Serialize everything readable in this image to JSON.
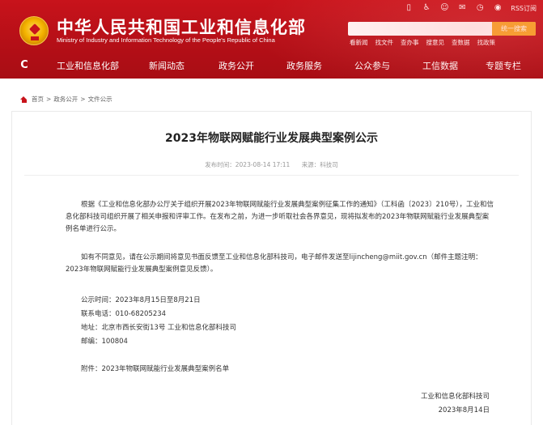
{
  "header": {
    "title": "中华人民共和国工业和信息化部",
    "subtitle": "Ministry of Industry and Information Technology of the People's Republic of China",
    "top_icons": [
      "mobile-icon",
      "accessibility-icon",
      "elder-icon",
      "mail-icon",
      "clock-icon",
      "weibo-icon"
    ],
    "rss_label": "RSS订阅",
    "search_placeholder": "",
    "search_button": "统一搜索",
    "hot_links": [
      "看新闻",
      "找文件",
      "查办事",
      "搜意见",
      "查数据",
      "找政策"
    ]
  },
  "nav": {
    "items": [
      "工业和信息化部",
      "新闻动态",
      "政务公开",
      "政务服务",
      "公众参与",
      "工信数据",
      "专题专栏"
    ]
  },
  "breadcrumb": [
    "首页",
    "政务公开",
    "文件公示"
  ],
  "article": {
    "title": "2023年物联网赋能行业发展典型案例公示",
    "publish_label": "发布时间：2023-08-14 17:11",
    "source_label": "来源：科技司",
    "p1": "根据《工业和信息化部办公厅关于组织开展2023年物联网赋能行业发展典型案例征集工作的通知》（工科函〔2023〕210号），工业和信息化部科技司组织开展了相关申报和评审工作。在发布之前，为进一步听取社会各界意见，现将拟发布的2023年物联网赋能行业发展典型案例名单进行公示。",
    "p2": "如有不同意见，请在公示期间将意见书面反馈至工业和信息化部科技司，电子邮件发送至lijincheng@miit.gov.cn（邮件主题注明：2023年物联网赋能行业发展典型案例意见反馈）。",
    "period": "公示时间：2023年8月15日至8月21日",
    "phone": "联系电话：010-68205234",
    "address": "地址：北京市西长安街13号 工业和信息化部科技司",
    "postcode": "邮编：100804",
    "attachment": "附件：2023年物联网赋能行业发展典型案例名单",
    "sign_org": "工业和信息化部科技司",
    "sign_date": "2023年8月14日"
  },
  "colors": {
    "header_red": "#c8131b",
    "search_button": "#f5a623"
  }
}
